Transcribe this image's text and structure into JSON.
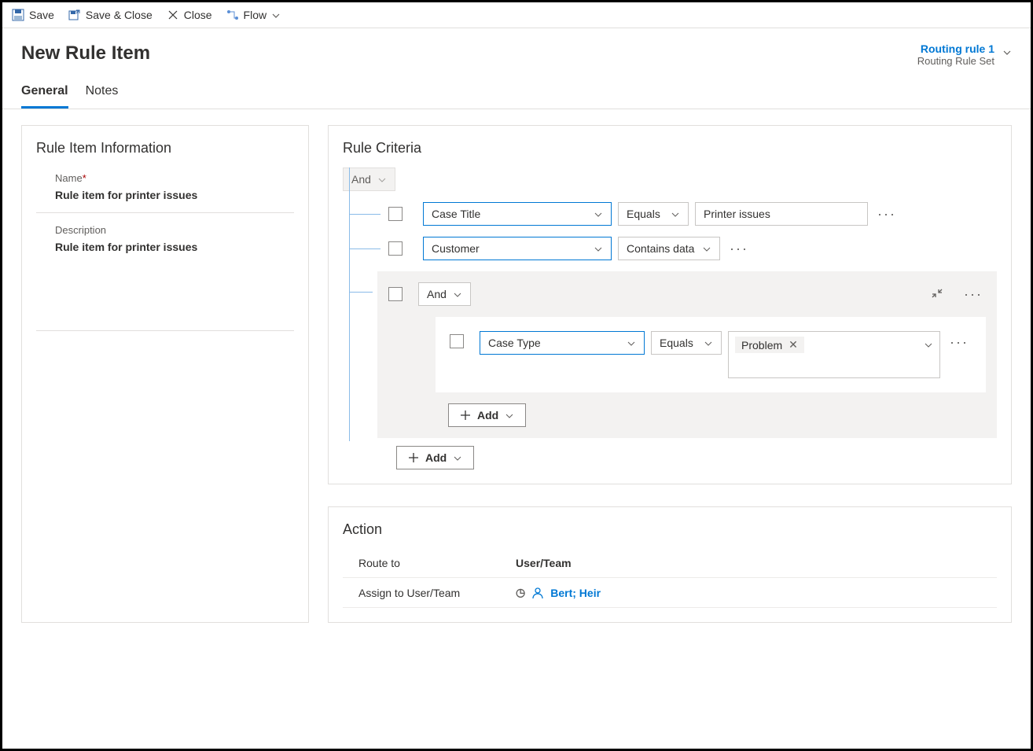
{
  "toolbar": {
    "save": "Save",
    "save_close": "Save & Close",
    "close": "Close",
    "flow": "Flow"
  },
  "header": {
    "title": "New Rule Item",
    "link": "Routing rule 1",
    "sub": "Routing Rule Set"
  },
  "tabs": {
    "general": "General",
    "notes": "Notes"
  },
  "info": {
    "section_title": "Rule Item Information",
    "name_label": "Name",
    "name_value": "Rule item for printer issues",
    "desc_label": "Description",
    "desc_value": "Rule item for printer issues"
  },
  "criteria": {
    "title": "Rule Criteria",
    "root_op": "And",
    "row1": {
      "field": "Case Title",
      "op": "Equals",
      "value": "Printer issues"
    },
    "row2": {
      "field": "Customer",
      "op": "Contains data"
    },
    "nested": {
      "op": "And",
      "row": {
        "field": "Case Type",
        "op": "Equals",
        "tag": "Problem"
      },
      "add": "Add"
    },
    "add": "Add"
  },
  "action": {
    "title": "Action",
    "route_label": "Route to",
    "route_value": "User/Team",
    "assign_label": "Assign to User/Team",
    "assign_value": "Bert; Heir"
  }
}
